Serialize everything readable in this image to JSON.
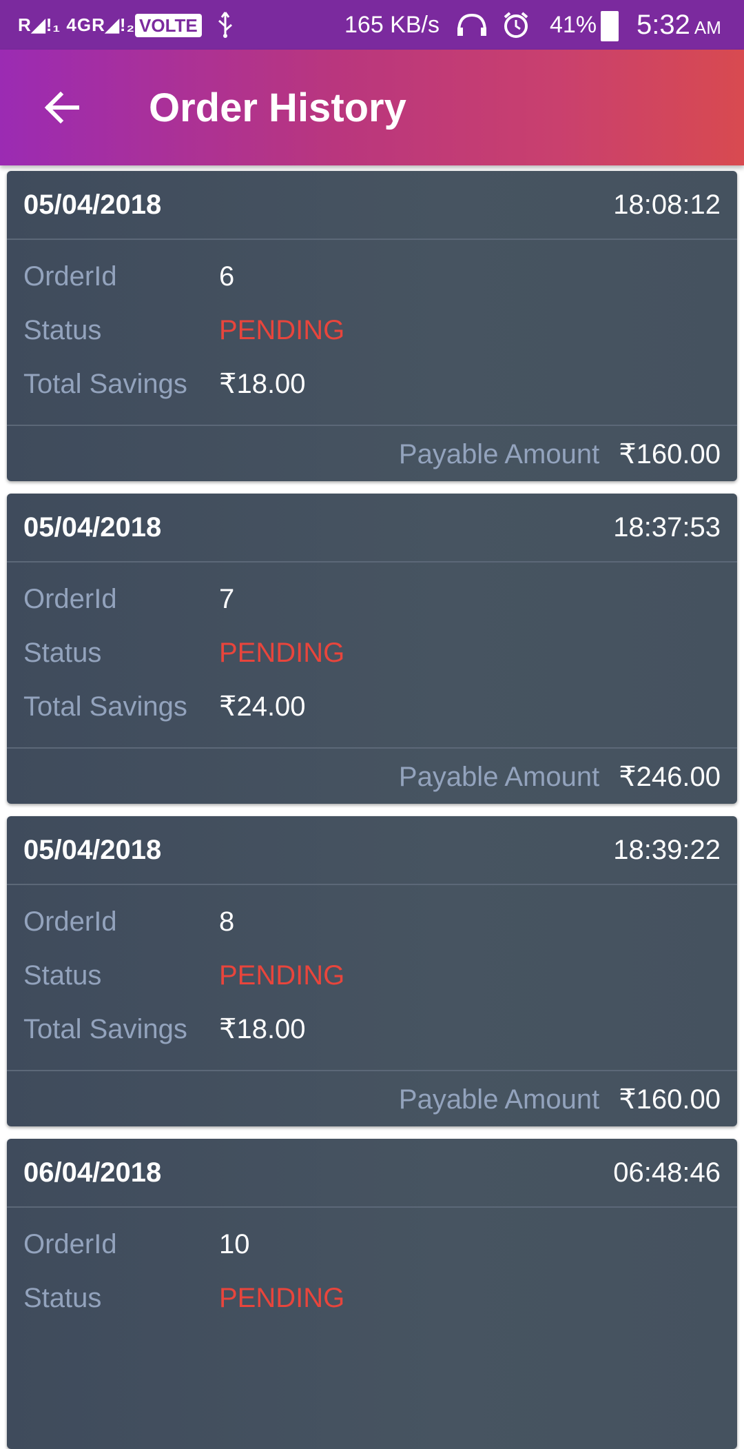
{
  "status_bar": {
    "signal": "R◢!₁ 4GR◢!₂",
    "volte": "VOLTE",
    "usb_icon": "usb-icon",
    "speed": "165 KB/s",
    "headset_icon": "hifi-headset-icon",
    "alarm_icon": "alarm-icon",
    "battery": "41%",
    "time": "5:32",
    "ampm": "AM"
  },
  "app_bar": {
    "back_icon": "arrow-left-icon",
    "title": "Order History"
  },
  "labels": {
    "order_id": "OrderId",
    "status": "Status",
    "total_savings": "Total Savings",
    "payable_amount": "Payable Amount"
  },
  "orders": [
    {
      "date": "05/04/2018",
      "time": "18:08:12",
      "order_id": "6",
      "status": "PENDING",
      "savings": "₹18.00",
      "payable": "₹160.00"
    },
    {
      "date": "05/04/2018",
      "time": "18:37:53",
      "order_id": "7",
      "status": "PENDING",
      "savings": "₹24.00",
      "payable": "₹246.00"
    },
    {
      "date": "05/04/2018",
      "time": "18:39:22",
      "order_id": "8",
      "status": "PENDING",
      "savings": "₹18.00",
      "payable": "₹160.00"
    },
    {
      "date": "06/04/2018",
      "time": "06:48:46",
      "order_id": "10",
      "status": "PENDING"
    }
  ],
  "colors": {
    "status_bar": "#7b2a9e",
    "app_bar_start": "#9b2bb3",
    "app_bar_end": "#d84a50",
    "card_bg": "#434f5e",
    "label": "#93a3bd",
    "pending": "#e8453c"
  }
}
